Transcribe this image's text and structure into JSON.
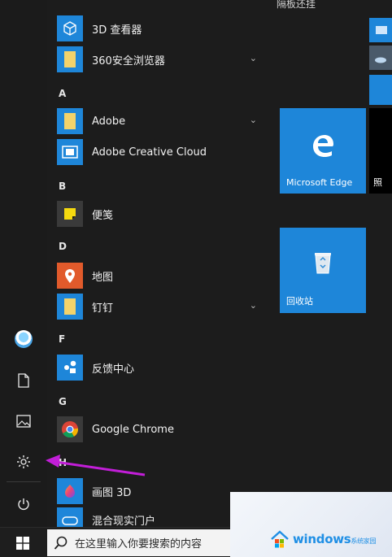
{
  "top": {
    "partial_text": "隔板还挂"
  },
  "rail": {
    "items": [
      {
        "name": "avatar",
        "icon": "user-avatar-icon"
      },
      {
        "name": "documents",
        "icon": "document-icon"
      },
      {
        "name": "pictures",
        "icon": "pictures-icon"
      },
      {
        "name": "settings",
        "icon": "gear-icon"
      },
      {
        "name": "power",
        "icon": "power-icon"
      }
    ]
  },
  "app_list": {
    "items": [
      {
        "label": "3D 查看器",
        "icon": "cube-3d-icon"
      },
      {
        "label": "360安全浏览器",
        "icon": "folder-icon",
        "expandable": true
      },
      {
        "letter": "A"
      },
      {
        "label": "Adobe",
        "icon": "folder-icon",
        "expandable": true
      },
      {
        "label": "Adobe Creative Cloud",
        "icon": "adobe-cc-icon"
      },
      {
        "letter": "B"
      },
      {
        "label": "便笺",
        "icon": "sticky-note-icon"
      },
      {
        "letter": "D"
      },
      {
        "label": "地图",
        "icon": "map-pin-icon"
      },
      {
        "label": "钉钉",
        "icon": "folder-icon",
        "expandable": true
      },
      {
        "letter": "F"
      },
      {
        "label": "反馈中心",
        "icon": "feedback-hub-icon"
      },
      {
        "letter": "G"
      },
      {
        "label": "Google Chrome",
        "icon": "chrome-icon"
      },
      {
        "letter": "H"
      },
      {
        "label": "画图 3D",
        "icon": "paint3d-icon"
      },
      {
        "label": "混合现实门户",
        "icon": "mixed-reality-icon"
      }
    ]
  },
  "tiles": {
    "edge_label": "Microsoft Edge",
    "recycle_label": "回收站",
    "side_partial": "照"
  },
  "taskbar": {
    "search_placeholder": "在这里输入你要搜索的内容"
  },
  "watermark": {
    "text": "windows",
    "sub": "系统家园"
  },
  "colors": {
    "accent": "#1e86d9",
    "arrow": "#c21ed8",
    "background": "#1c1c1c"
  }
}
